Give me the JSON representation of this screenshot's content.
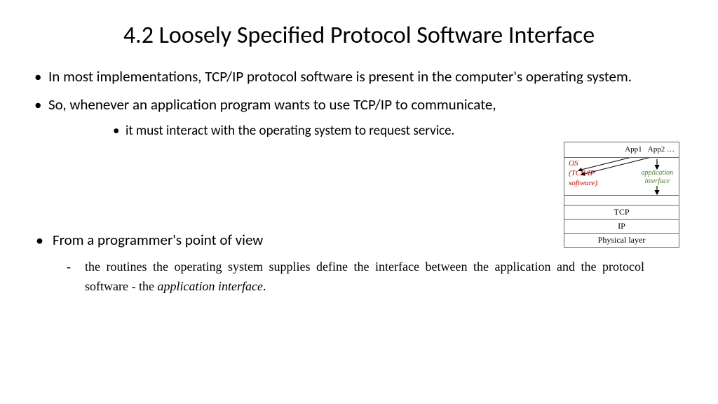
{
  "title": "4.2 Loosely Specified Protocol Software Interface",
  "bullets": {
    "b1": "In most implementations, TCP/IP protocol software is present in the computer's operating system.",
    "b2": "So, whenever an application program wants to use TCP/IP to communicate,",
    "b2_sub": "it must interact with the operating system to request service."
  },
  "pov": "From a programmer's point of view",
  "dash_pre": "the routines the operating system supplies define the interface between the application and the protocol software -  the ",
  "dash_italic": "application interface",
  "dash_post": ".",
  "diagram": {
    "app1": "App1",
    "app2": "App2",
    "dots": "…",
    "os_l1": "OS",
    "os_l2": "(TCP/IP",
    "os_l3": "software)",
    "ai_l1": "application",
    "ai_l2": "interface",
    "tcp": "TCP",
    "ip": "IP",
    "phys": "Physical layer"
  }
}
